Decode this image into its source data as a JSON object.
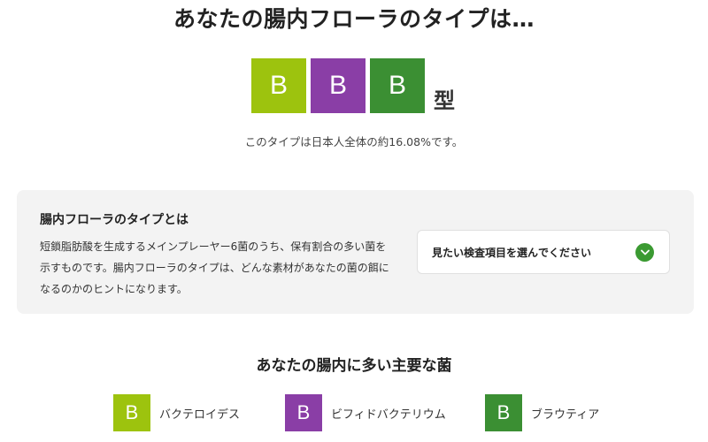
{
  "hero": {
    "title": "あなたの腸内フローラのタイプは…"
  },
  "type_result": {
    "letters": [
      {
        "letter": "B",
        "color": "#9dc30e"
      },
      {
        "letter": "B",
        "color": "#8a3ea6"
      },
      {
        "letter": "B",
        "color": "#3b8f33"
      }
    ],
    "suffix": "型",
    "percent_text": "このタイプは日本人全体の約16.08%です。"
  },
  "info_panel": {
    "title": "腸内フローラのタイプとは",
    "description": "短鎖脂肪酸を生成するメインプレーヤー6菌のうち、保有割合の多い菌を示すものです。腸内フローラのタイプは、どんな素材があなたの菌の餌になるのかのヒントになります。",
    "dropdown": {
      "label": "見たい検査項目を選んでください",
      "icon": "chevron-down-icon",
      "icon_color": "#3b9a32"
    }
  },
  "main_bacteria": {
    "title": "あなたの腸内に多い主要な菌",
    "items": [
      {
        "letter": "B",
        "name": "バクテロイデス",
        "color": "#9dc30e"
      },
      {
        "letter": "B",
        "name": "ビフィドバクテリウム",
        "color": "#8a3ea6"
      },
      {
        "letter": "B",
        "name": "ブラウティア",
        "color": "#3b8f33"
      }
    ]
  }
}
